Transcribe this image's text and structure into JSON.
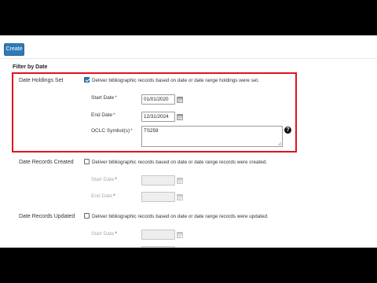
{
  "toolbar": {
    "create_label": "Create"
  },
  "filter": {
    "title": "Filter by Date",
    "holdings_set": {
      "label": "Date Holdings Set",
      "checkbox_text": "Deliver bibliographic records based on date or date range holdings were set.",
      "checked": true,
      "start_label": "Start Date",
      "start_value": "01/01/2020",
      "end_label": "End Date",
      "end_value": "12/31/2024",
      "oclc_label": "OCLC Symbol(s)",
      "oclc_value": "TS259",
      "required_mark": "*",
      "help_glyph": "?"
    },
    "records_created": {
      "label": "Date Records Created",
      "checkbox_text": "Deliver bibliographic records based on date or date range records were created.",
      "checked": false,
      "start_label": "Start Date",
      "end_label": "End Date",
      "required_mark": "*"
    },
    "records_updated": {
      "label": "Date Records Updated",
      "checkbox_text": "Deliver bibliographic records based on date or date range records were updated.",
      "checked": false,
      "start_label": "Start Date",
      "required_mark": "*"
    }
  },
  "colors": {
    "accent": "#2d7ab8",
    "highlight": "#e0141c",
    "required": "#d9161f"
  }
}
